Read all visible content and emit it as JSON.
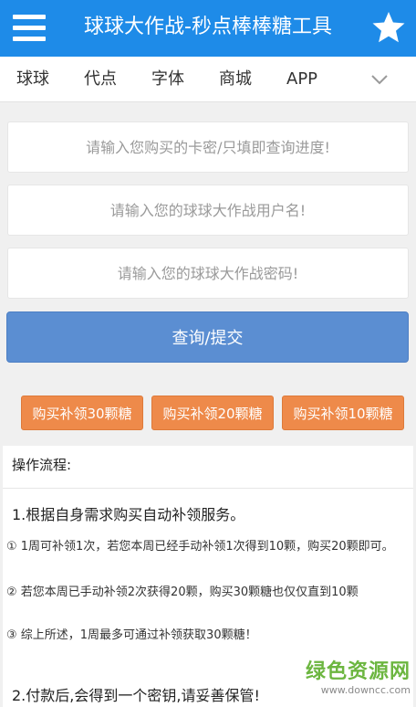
{
  "header": {
    "title": "球球大作战-秒点棒棒糖工具",
    "menu_icon": "hamburger-menu-icon",
    "star_icon": "star-icon",
    "color": "#1e8be8"
  },
  "nav": {
    "items": [
      "球球",
      "代点",
      "字体",
      "商城",
      "APP"
    ],
    "expand_icon": "chevron-down-icon"
  },
  "form": {
    "card_placeholder": "请输入您购买的卡密/只填即查询进度!",
    "username_placeholder": "请输入您的球球大作战用户名!",
    "password_placeholder": "请输入您的球球大作战密码!",
    "submit_label": "查询/提交",
    "submit_color": "#5b8ed2"
  },
  "purchase": {
    "buttons": [
      "购买补领30颗糖",
      "购买补领20颗糖",
      "购买补领10颗糖"
    ],
    "color": "#ee8a4a"
  },
  "process": {
    "title": "操作流程:",
    "step1": "1.根据自身需求购买自动补领服务。",
    "note1": "① 1周可补领1次，若您本周已经手动补领1次得到10颗，购买20颗即可。",
    "note2": "② 若您本周已手动补领2次获得20颗，购买30颗糖也仅仅直到10颗",
    "note3": "③ 综上所述，1周最多可通过补领获取30颗糖！",
    "step2": "2.付款后,会得到一个密钥,请妥善保管!"
  },
  "watermark": {
    "text": "绿色资源网",
    "url": "www.downcc.com"
  }
}
